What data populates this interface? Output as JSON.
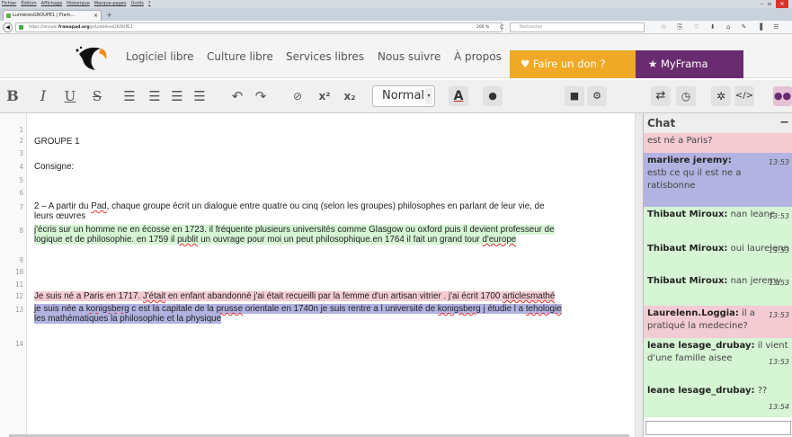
{
  "browser": {
    "menu": [
      "Fichier",
      "Édition",
      "Affichage",
      "Historique",
      "Marque-pages",
      "Outils",
      "?"
    ],
    "tab_title": "LumièresGROUPE1 | Fram...",
    "tab_close": "×",
    "new_tab": "+",
    "url_prefix": "https://annuel.",
    "url_domain": "framapad.org",
    "url_path": "/p/LumièresGROUPE1",
    "zoom": "200 %",
    "search_placeholder": "Rechercher",
    "reload": "C"
  },
  "header": {
    "nav": [
      "Logiciel libre",
      "Culture libre",
      "Services libres",
      "Nous suivre",
      "À propos"
    ],
    "donate": "Faire un don ?",
    "myframa": "MyFrama",
    "colors": {
      "donate": "#f0a926",
      "myframa": "#6a2c70",
      "logo": "#ef8c1a"
    }
  },
  "toolbar": {
    "bold": "B",
    "italic": "I",
    "underline": "U",
    "strike": "S",
    "style_select": "Normal",
    "superscript": "x²",
    "subscript": "x₂",
    "color": "A"
  },
  "editor": {
    "line_numbers": [
      "1",
      "2",
      "3",
      "4",
      "5",
      "6",
      "7",
      "8",
      "9",
      "10",
      "11",
      "12",
      "13",
      "14"
    ],
    "lines": {
      "l2": "GROUPE 1",
      "l4": "Consigne:",
      "l7a": "2 – A partir du ",
      "l7b": "Pad",
      "l7c": ", chaque groupe écrit un dialogue entre quatre ou cinq (selon les groupes) philosophes en parlant de leur vie, de",
      "l7d": "leurs œuvres",
      "l8a": "j'écris sur un homme ne en écosse en 1723. il fréquente plusieurs universités comme Glasgow ou oxford puis il devient professeur de",
      "l8b": "logique et de philosophie. en 1759 il ",
      "l8c": "publit",
      "l8d": " un ouvrage pour moi un peut philosophique.en 1764 il fait un grand tour ",
      "l8e": "d'europe",
      "l12a": "Je suis né a Paris en 1717. ",
      "l12b": "J'était",
      "l12c": " en enfant abandonné j'ai était recueilli par la femme d'un artisan vitrier . j'ai écrit 1700 ",
      "l12d": "articlesmathé",
      "l13a": "je suis née a ",
      "l13b": "konigsberg",
      "l13c": " c est la capitale de la ",
      "l13d": "prusse",
      "l13e": "  orientale en 1740n je suis rentre a l université de ",
      "l13f": "konigsberg",
      "l13g": " j étudie l a ",
      "l13h": "tehologie",
      "l13i": "les mathématiques la philosophie et la physique"
    }
  },
  "chat": {
    "title": "Chat",
    "minimize": "−",
    "messages": [
      {
        "author": "",
        "text": "est né a Paris?",
        "time": ""
      },
      {
        "author": "marliere jeremy:",
        "text": "estb ce qu il est ne a ratisbonne",
        "time": "13:53"
      },
      {
        "author": "Thibaut Miroux:",
        "text": "nan leane",
        "time": "13:53"
      },
      {
        "author": "Thibaut Miroux:",
        "text": "oui laurelenn",
        "time": "13:53"
      },
      {
        "author": "Thibaut Miroux:",
        "text": "nan jeremy",
        "time": "13:53"
      },
      {
        "author": "Laurelenn.Loggia:",
        "text": "il a pratiqué la medecine?",
        "time": "13:53"
      },
      {
        "author": "leane lesage_drubay:",
        "text": "il vient d'une famille aisee",
        "time": "13:53"
      },
      {
        "author": "leane lesage_drubay:",
        "text": "??",
        "time": "13:54"
      }
    ]
  }
}
